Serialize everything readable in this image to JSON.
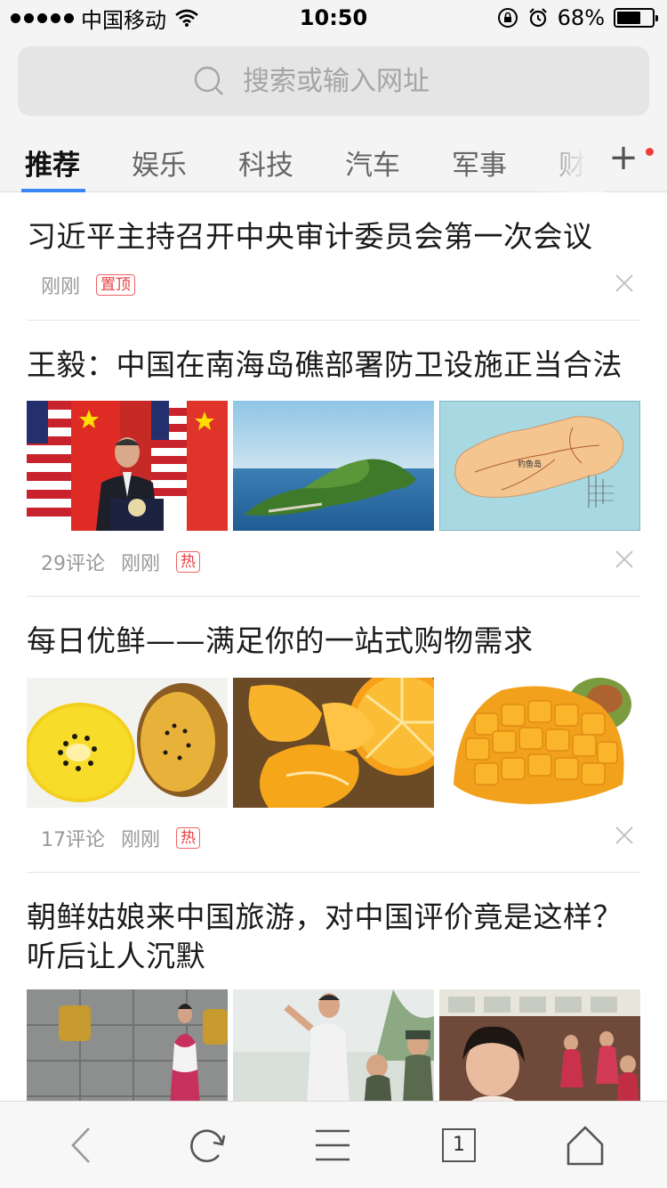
{
  "status_bar": {
    "carrier": "中国移动",
    "time": "10:50",
    "battery": "68%",
    "battery_level": 0.68
  },
  "search": {
    "placeholder": "搜索或输入网址"
  },
  "tabs": [
    {
      "label": "推荐",
      "active": true
    },
    {
      "label": "娱乐"
    },
    {
      "label": "科技"
    },
    {
      "label": "汽车"
    },
    {
      "label": "军事"
    },
    {
      "label": "财"
    }
  ],
  "feed": [
    {
      "title": "习近平主持召开中央审计委员会第一次会议",
      "time": "刚刚",
      "badge": "置顶"
    },
    {
      "title": "王毅：中国在南海岛礁部署防卫设施正当合法",
      "comments": "29评论",
      "time": "刚刚",
      "badge": "热",
      "map_label": "钓鱼岛"
    },
    {
      "title": "每日优鲜——满足你的一站式购物需求",
      "comments": "17评论",
      "time": "刚刚",
      "badge": "热"
    },
    {
      "title_line1": "朝鲜姑娘来中国旅游，对中国评价竟是这样？",
      "title_line2": "听后让人沉默"
    }
  ],
  "toolbar": {
    "tab_count": "1"
  },
  "colors": {
    "accent": "#3b86f7",
    "badge_red": "#e84040",
    "notification_dot": "#f23c3c"
  }
}
